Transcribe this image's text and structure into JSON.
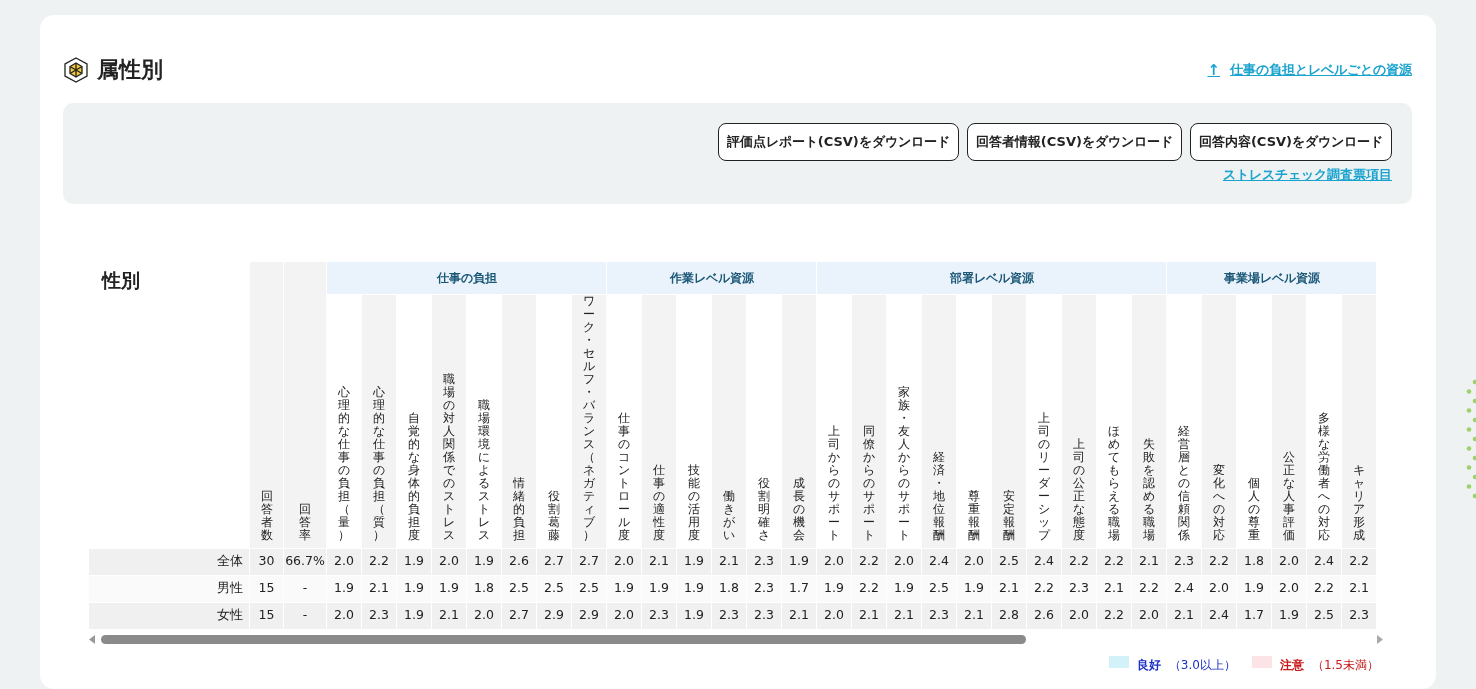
{
  "section": {
    "title": "属性別"
  },
  "nav_link": {
    "arrow": "↑",
    "label": "仕事の負担とレベルごとの資源"
  },
  "downloads": [
    "評価点レポート(CSV)をダウンロード",
    "回答者情報(CSV)をダウンロード",
    "回答内容(CSV)をダウンロード"
  ],
  "survey_link": "ストレスチェック調査票項目",
  "table": {
    "title": "性別",
    "fixed_columns": [
      "回答者数",
      "回答率"
    ],
    "groups": [
      {
        "label": "仕事の負担",
        "columns": [
          "心理的な仕事の負担（量）",
          "心理的な仕事の負担（質）",
          "自覚的な身体的負担度",
          "職場の対人関係でのストレス",
          "職場環境によるストレス",
          "情緒的負担",
          "役割葛藤",
          "ワーク・セルフ・バランス（ネガティブ）"
        ]
      },
      {
        "label": "作業レベル資源",
        "columns": [
          "仕事のコントロール度",
          "仕事の適性度",
          "技能の活用度",
          "働きがい",
          "役割明確さ",
          "成長の機会"
        ]
      },
      {
        "label": "部署レベル資源",
        "columns": [
          "上司からのサポート",
          "同僚からのサポート",
          "家族・友人からのサポート",
          "経済・地位報酬",
          "尊重報酬",
          "安定報酬",
          "上司のリーダーシップ",
          "上司の公正な態度",
          "ほめてもらえる職場",
          "失敗を認める職場"
        ]
      },
      {
        "label": "事業場レベル資源",
        "columns": [
          "経営層との信頼関係",
          "変化への対応",
          "個人の尊重",
          "公正な人事評価",
          "多様な労働者への対応",
          "キャリア形成"
        ]
      }
    ],
    "rows": [
      {
        "label": "全体",
        "count": "30",
        "rate": "66.7%",
        "values": [
          "2.0",
          "2.2",
          "1.9",
          "2.0",
          "1.9",
          "2.6",
          "2.7",
          "2.7",
          "2.0",
          "2.1",
          "1.9",
          "2.1",
          "2.3",
          "1.9",
          "2.0",
          "2.2",
          "2.0",
          "2.4",
          "2.0",
          "2.5",
          "2.4",
          "2.2",
          "2.2",
          "2.1",
          "2.3",
          "2.2",
          "1.8",
          "2.0",
          "2.4",
          "2.2"
        ]
      },
      {
        "label": "男性",
        "count": "15",
        "rate": "-",
        "values": [
          "1.9",
          "2.1",
          "1.9",
          "1.9",
          "1.8",
          "2.5",
          "2.5",
          "2.5",
          "1.9",
          "1.9",
          "1.9",
          "1.8",
          "2.3",
          "1.7",
          "1.9",
          "2.2",
          "1.9",
          "2.5",
          "1.9",
          "2.1",
          "2.2",
          "2.3",
          "2.1",
          "2.2",
          "2.4",
          "2.0",
          "1.9",
          "2.0",
          "2.2",
          "2.1"
        ]
      },
      {
        "label": "女性",
        "count": "15",
        "rate": "-",
        "values": [
          "2.0",
          "2.3",
          "1.9",
          "2.1",
          "2.0",
          "2.7",
          "2.9",
          "2.9",
          "2.0",
          "2.3",
          "1.9",
          "2.3",
          "2.3",
          "2.1",
          "2.0",
          "2.1",
          "2.1",
          "2.3",
          "2.1",
          "2.8",
          "2.6",
          "2.0",
          "2.2",
          "2.0",
          "2.1",
          "2.4",
          "1.7",
          "1.9",
          "2.5",
          "2.3"
        ]
      }
    ]
  },
  "legend": [
    {
      "kind": "good",
      "label": "良好",
      "note": "（3.0以上）",
      "color": "#d3f1f9"
    },
    {
      "kind": "caution",
      "label": "注意",
      "note": "（1.5未満）",
      "color": "#fce3e6"
    }
  ]
}
